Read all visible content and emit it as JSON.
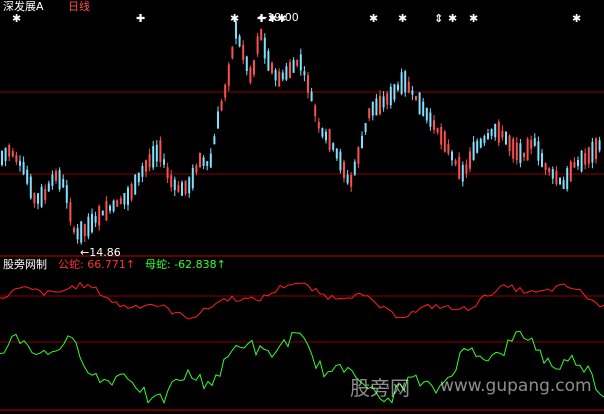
{
  "header": {
    "symbol": "深发展A",
    "period": "日线"
  },
  "price_panel": {
    "high_label": "←19.00",
    "low_label": "←14.86",
    "signal_marker": "✱"
  },
  "indicator": {
    "name": "股旁网制",
    "s1_label": "公蛇: 66.771↑",
    "s2_label": "母蛇: -62.838↑",
    "s1_color": "#ff2020",
    "s2_color": "#30ff30"
  },
  "watermark": {
    "cn": "股旁网",
    "url": "www.gupang.com"
  },
  "colors": {
    "up": "#ff5050",
    "down": "#80e0ff",
    "grid": "#8b0000",
    "bg": "#000000"
  }
}
